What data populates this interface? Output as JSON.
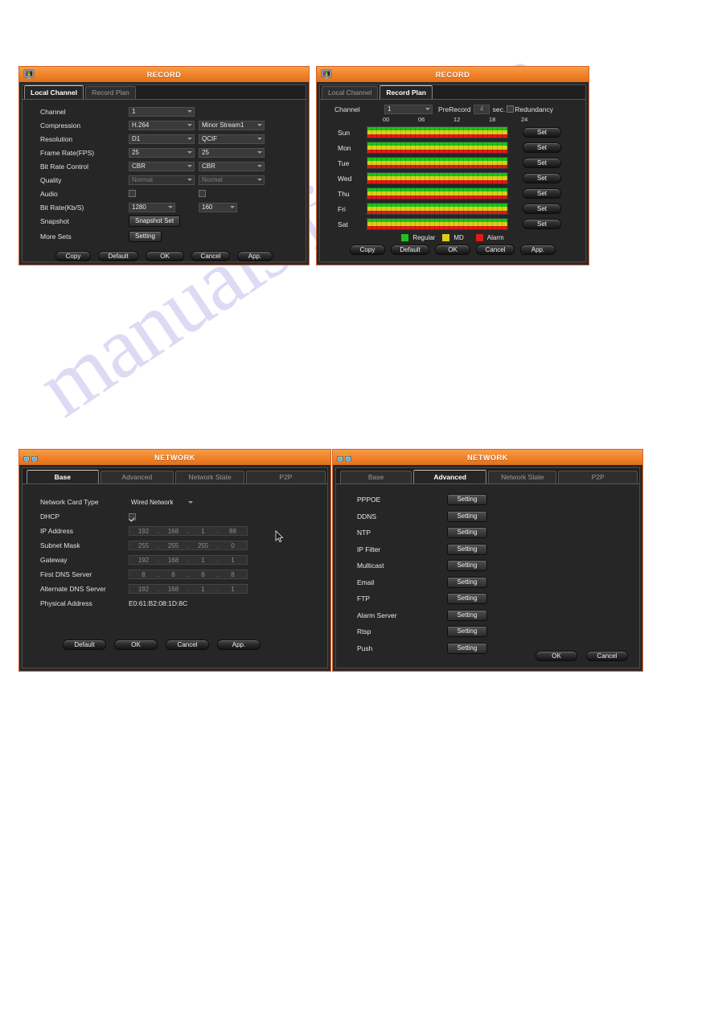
{
  "watermark": {
    "text": "manualshive.com",
    "color": "#c9c4ee"
  },
  "theme": {
    "title_bar_orange": "#f2862c",
    "dialog_border": "#d4622a",
    "body_dark": "#262626",
    "regular_green": "#19c419",
    "md_yellow": "#d8cf17",
    "alarm_red": "#e01b16"
  },
  "record_local": {
    "title": "RECORD",
    "icon": "monitor-icon",
    "tabs": [
      {
        "label": "Local Channel",
        "active": true
      },
      {
        "label": "Record Plan",
        "active": false
      }
    ],
    "fields": [
      {
        "label": "Channel",
        "main": "1",
        "sub": null,
        "dim": false
      },
      {
        "label": "Compression",
        "main": "H.264",
        "sub": "Minor Stream1",
        "dim": false
      },
      {
        "label": "Resolution",
        "main": "D1",
        "sub": "QCIF",
        "dim": false
      },
      {
        "label": "Frame Rate(FPS)",
        "main": "25",
        "sub": "25",
        "dim": false
      },
      {
        "label": "Bit Rate Control",
        "main": "CBR",
        "sub": "CBR",
        "dim": false
      },
      {
        "label": "Quality",
        "main": "Normal",
        "sub": "Normal",
        "dim": true
      }
    ],
    "audio": {
      "label": "Audio",
      "main_checked": false,
      "sub_checked": false
    },
    "bitrate": {
      "label": "Bit Rate(Kb/S)",
      "main": "1280",
      "sub": "160"
    },
    "snapshot": {
      "label": "Snapshot",
      "button": "Snapshot Set"
    },
    "more_sets": {
      "label": "More Sets",
      "button": "Setting"
    },
    "buttons": [
      "Copy",
      "Default",
      "OK",
      "Cancel",
      "App."
    ]
  },
  "record_plan": {
    "title": "RECORD",
    "icon": "monitor-icon",
    "tabs": [
      {
        "label": "Local Channel",
        "active": false
      },
      {
        "label": "Record Plan",
        "active": true
      }
    ],
    "channel": {
      "label": "Channel",
      "value": "1"
    },
    "prerecord": {
      "label": "PreRecord",
      "value": "4",
      "unit": "sec."
    },
    "redundancy": {
      "label": "Redundancy",
      "checked": false
    },
    "hour_ticks": [
      "00",
      "06",
      "12",
      "18",
      "24"
    ],
    "days": [
      {
        "name": "Sun",
        "set": "Set"
      },
      {
        "name": "Mon",
        "set": "Set"
      },
      {
        "name": "Tue",
        "set": "Set"
      },
      {
        "name": "Wed",
        "set": "Set"
      },
      {
        "name": "Thu",
        "set": "Set"
      },
      {
        "name": "Fri",
        "set": "Set"
      },
      {
        "name": "Sat",
        "set": "Set"
      }
    ],
    "legend": [
      {
        "label": "Regular",
        "color": "#19c419"
      },
      {
        "label": "MD",
        "color": "#d8cf17"
      },
      {
        "label": "Alarm",
        "color": "#e01b16"
      }
    ],
    "buttons": [
      "Copy",
      "Default",
      "OK",
      "Cancel",
      "App."
    ]
  },
  "network_base": {
    "title": "NETWORK",
    "icon": "network-icon",
    "tabs": [
      {
        "label": "Base",
        "active": true
      },
      {
        "label": "Advanced",
        "active": false
      },
      {
        "label": "Network State",
        "active": false
      },
      {
        "label": "P2P",
        "active": false
      }
    ],
    "card_type": {
      "label": "Network Card Type",
      "value": "Wired Network"
    },
    "dhcp": {
      "label": "DHCP",
      "checked": true
    },
    "ip_rows": [
      {
        "label": "IP Address",
        "octets": [
          "192",
          "168",
          "1",
          "88"
        ]
      },
      {
        "label": "Subnet Mask",
        "octets": [
          "255",
          "255",
          "255",
          "0"
        ]
      },
      {
        "label": "Gateway",
        "octets": [
          "192",
          "168",
          "1",
          "1"
        ]
      },
      {
        "label": "First DNS Server",
        "octets": [
          "8",
          "8",
          "8",
          "8"
        ]
      },
      {
        "label": "Alternate DNS Server",
        "octets": [
          "192",
          "168",
          "1",
          "1"
        ]
      }
    ],
    "physical_address": {
      "label": "Physical Address",
      "value": "E0:61:B2:08:1D:8C"
    },
    "buttons": [
      "Default",
      "OK",
      "Cancel",
      "App."
    ]
  },
  "network_advanced": {
    "title": "NETWORK",
    "icon": "network-icon",
    "tabs": [
      {
        "label": "Base",
        "active": false
      },
      {
        "label": "Advanced",
        "active": true
      },
      {
        "label": "Network State",
        "active": false
      },
      {
        "label": "P2P",
        "active": false
      }
    ],
    "items": [
      {
        "label": "PPPOE",
        "button": "Setting"
      },
      {
        "label": "DDNS",
        "button": "Setting"
      },
      {
        "label": "NTP",
        "button": "Setting"
      },
      {
        "label": "IP Filter",
        "button": "Setting"
      },
      {
        "label": "Multicast",
        "button": "Setting"
      },
      {
        "label": "Email",
        "button": "Setting"
      },
      {
        "label": "FTP",
        "button": "Setting"
      },
      {
        "label": "Alarm Server",
        "button": "Setting"
      },
      {
        "label": "Rtsp",
        "button": "Setting"
      },
      {
        "label": "Push",
        "button": "Setting"
      }
    ],
    "buttons": [
      "OK",
      "Cancel"
    ]
  }
}
